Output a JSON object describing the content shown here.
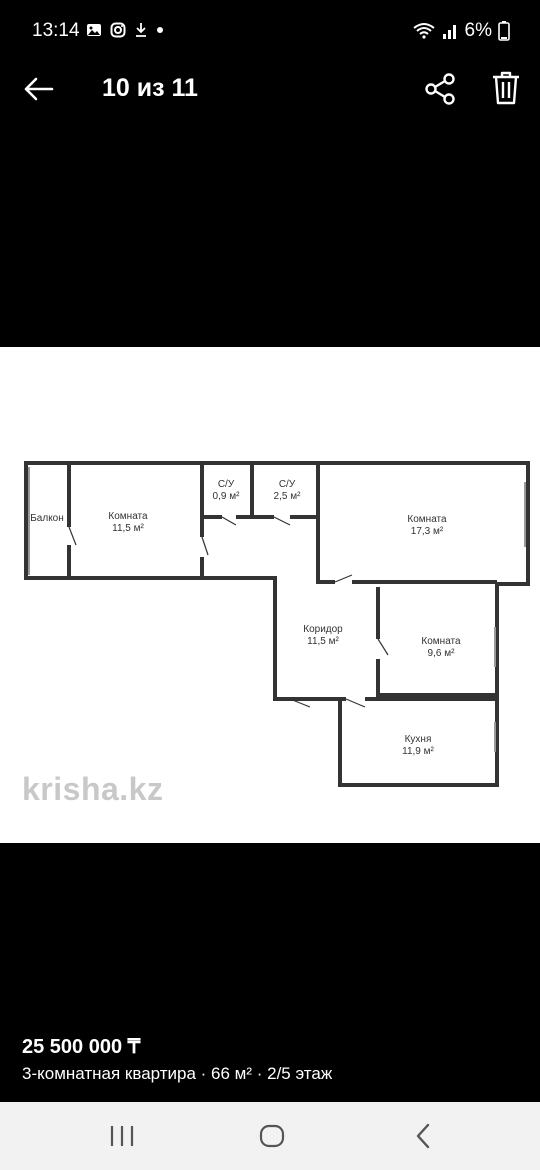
{
  "status_bar": {
    "time": "13:14",
    "battery": "6%",
    "icons": [
      "gallery-icon",
      "instagram-icon",
      "download-icon",
      "dot-icon",
      "wifi-icon",
      "signal-icon",
      "battery-icon"
    ]
  },
  "app_bar": {
    "title": "10 из 11",
    "icons": [
      "back-arrow-icon",
      "share-icon",
      "trash-icon"
    ]
  },
  "floor_plan": {
    "rooms": {
      "balcony": "Балкон",
      "room1_name": "Комната",
      "room1_area": "11,5 м²",
      "bath1_name": "С/У",
      "bath1_area": "0,9 м²",
      "bath2_name": "С/У",
      "bath2_area": "2,5 м²",
      "room2_name": "Комната",
      "room2_area": "17,3 м²",
      "corridor_name": "Коридор",
      "corridor_area": "11,5 м²",
      "room3_name": "Комната",
      "room3_area": "9,6 м²",
      "kitchen_name": "Кухня",
      "kitchen_area": "11,9 м²"
    },
    "watermark": "krisha.kz"
  },
  "listing": {
    "price": "25 500 000 ₸",
    "description": "3-комнатная квартира · 66 м² · 2/5 этаж"
  },
  "nav_bar": {
    "icons": [
      "recent-apps-icon",
      "home-icon",
      "back-icon"
    ]
  }
}
